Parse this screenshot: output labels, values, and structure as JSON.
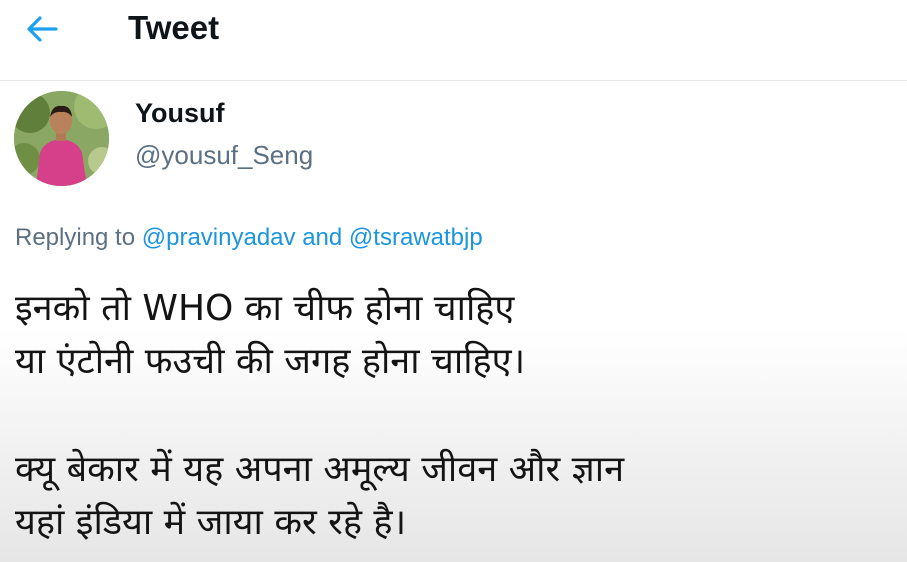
{
  "header": {
    "title": "Tweet",
    "back_icon": "arrow-left-icon",
    "accent_color": "#1da1f2"
  },
  "author": {
    "name": "Yousuf",
    "handle": "@yousuf_Seng"
  },
  "reply": {
    "prefix": "Replying to",
    "mention_1": "@pravinyadav",
    "conjunction": "and",
    "mention_2": "@tsrawatbjp"
  },
  "tweet": {
    "lines": [
      "इनको तो WHO का चीफ होना चाहिए",
      "या एंटोनी फउची की जगह होना चाहिए।",
      "क्यू बेकार में यह अपना अमूल्य जीवन और ज्ञान",
      "यहां इंडिया में जाया कर रहे है।"
    ]
  },
  "colors": {
    "mention": "#1b95e0",
    "secondary_text": "#5b7083"
  }
}
